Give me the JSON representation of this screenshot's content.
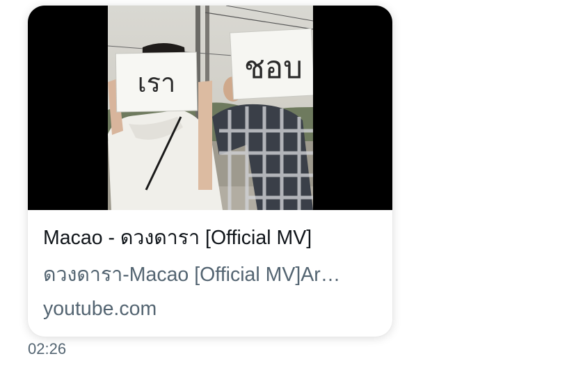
{
  "link_card": {
    "title": "Macao - ดวงดารา [Official MV]",
    "description": "ดวงดารา-Macao [Official MV]Ar…",
    "domain": "youtube.com",
    "thumbnail": {
      "sign_left_text": "เรา",
      "sign_right_text": "ชอบ"
    }
  },
  "message": {
    "timestamp": "02:26"
  }
}
